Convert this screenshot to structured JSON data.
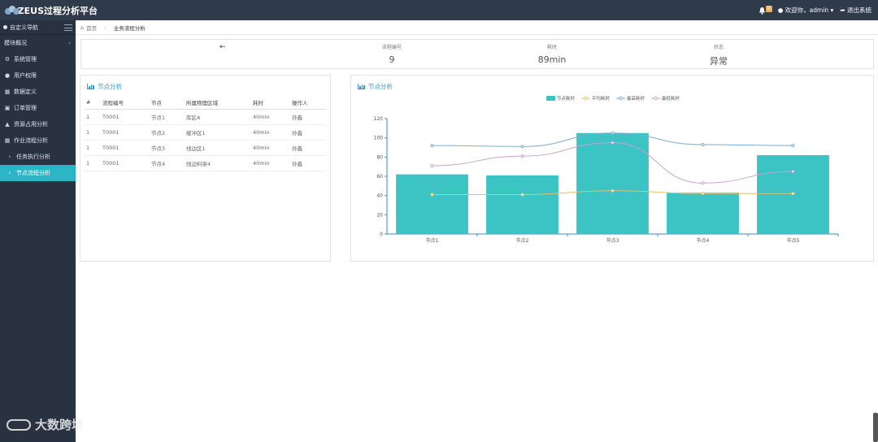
{
  "header": {
    "title": "ZEUS过程分析平台",
    "bell_count": "0",
    "welcome": "欢迎你，admin",
    "logout": "退出系统"
  },
  "sidebar": {
    "head": "自定义导航",
    "items": [
      {
        "label": "模块概况",
        "icon": ""
      },
      {
        "label": "系统管理",
        "icon": "gear-icon"
      },
      {
        "label": "用户权限",
        "icon": "user-icon"
      },
      {
        "label": "数据定义",
        "icon": "list-icon"
      },
      {
        "label": "订单管理",
        "icon": "cart-icon"
      },
      {
        "label": "资源占用分析",
        "icon": "chart-icon"
      },
      {
        "label": "作业流程分析",
        "icon": "list-icon"
      },
      {
        "label": "任务执行分析",
        "icon": "chevron-right-icon"
      },
      {
        "label": "节点流程分析",
        "icon": "chevron-right-icon"
      }
    ]
  },
  "breadcrumb": {
    "home": "首页",
    "current": "业务流程分析"
  },
  "summary": {
    "back": "←",
    "stats": [
      {
        "label": "流程编号",
        "value": "9"
      },
      {
        "label": "耗时",
        "value": "89min"
      },
      {
        "label": "状态",
        "value": "异常"
      }
    ]
  },
  "left_panel": {
    "title": "节点分析",
    "columns": [
      "#",
      "流程编号",
      "节点",
      "所属物理区域",
      "耗时",
      "操作人"
    ],
    "rows": [
      [
        "1",
        "T0001",
        "节点1",
        "库区A",
        "40min",
        "孙鑫"
      ],
      [
        "1",
        "T0001",
        "节点2",
        "缓冲区1",
        "40min",
        "孙鑫"
      ],
      [
        "1",
        "T0001",
        "节点3",
        "线边区1",
        "40min",
        "孙鑫"
      ],
      [
        "1",
        "T0001",
        "节点4",
        "线边料架4",
        "40min",
        "孙鑫"
      ]
    ]
  },
  "right_panel": {
    "title": "节点分析"
  },
  "chart_data": {
    "type": "bar",
    "categories": [
      "节点1",
      "节点2",
      "节点3",
      "节点4",
      "节点5"
    ],
    "series": [
      {
        "name": "节点耗时",
        "kind": "bar",
        "color": "#3cc3c4",
        "values": [
          62,
          61,
          105,
          43,
          82
        ]
      },
      {
        "name": "平均耗时",
        "kind": "line",
        "color": "#e2c36d",
        "values": [
          41,
          41,
          45,
          42,
          42
        ]
      },
      {
        "name": "最高耗时",
        "kind": "line",
        "color": "#7aaed3",
        "values": [
          92,
          91,
          105,
          93,
          92
        ]
      },
      {
        "name": "最低耗时",
        "kind": "line",
        "color": "#c9a3cf",
        "values": [
          71,
          81,
          95,
          53,
          65
        ]
      }
    ],
    "ylim": [
      0,
      120
    ],
    "yticks": [
      0,
      20,
      40,
      60,
      80,
      100,
      120
    ],
    "legend": "top-center",
    "grid": false
  },
  "footer": {
    "brand": "大数跨境"
  }
}
